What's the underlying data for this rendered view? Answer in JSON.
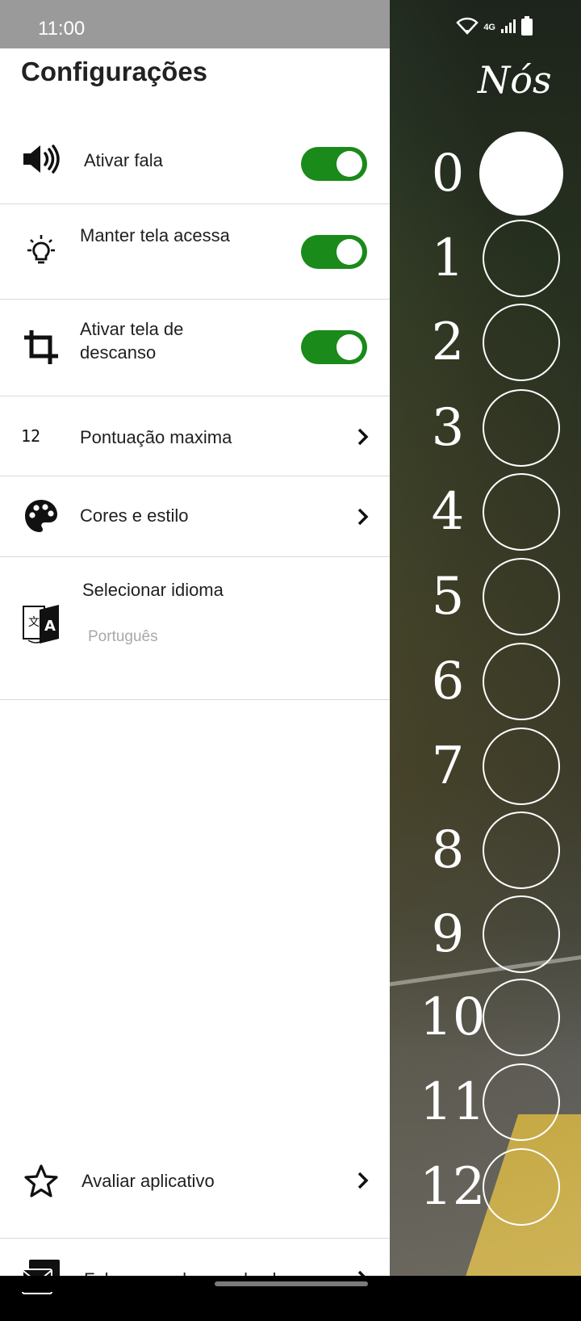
{
  "status_bar": {
    "time": "11:00",
    "network": "4G",
    "icons": [
      "wifi-icon",
      "signal-icon",
      "battery-icon"
    ]
  },
  "settings": {
    "title": "Configurações",
    "items": [
      {
        "label": "Ativar fala",
        "icon": "speaker-icon",
        "toggle": true
      },
      {
        "label": "Manter tela acessa",
        "icon": "lightbulb-icon",
        "toggle": true
      },
      {
        "label": "Ativar tela de descanso",
        "icon": "crop-icon",
        "toggle": true
      },
      {
        "label": "Pontuação maxima",
        "icon": "number-12-icon",
        "icon_text": "12"
      },
      {
        "label": "Cores e estilo",
        "icon": "palette-icon"
      },
      {
        "label": "Selecionar idioma",
        "value": "Português",
        "icon": "translate-icon"
      }
    ],
    "footer": [
      {
        "label": "Avaliar aplicativo",
        "icon": "star-icon"
      },
      {
        "label": "Fale com o desenvolvedor",
        "icon": "mail-icon"
      }
    ]
  },
  "scoreboard": {
    "title": "Nós",
    "numbers": [
      "0",
      "1",
      "2",
      "3",
      "4",
      "5",
      "6",
      "7",
      "8",
      "9",
      "10",
      "11",
      "12"
    ],
    "current_score": 0
  },
  "colors": {
    "toggle_on": "#1a8a1a",
    "drawer_bg": "#ffffff",
    "status_bar_bg": "#9a9a9a"
  }
}
